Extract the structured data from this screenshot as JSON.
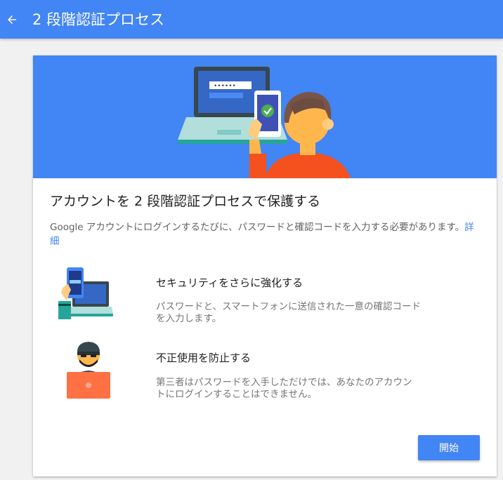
{
  "header": {
    "title": "2 段階認証プロセス",
    "back_icon": "arrow-back-icon"
  },
  "colors": {
    "primary": "#4285f4",
    "title_text": "#212121",
    "body_text": "#616161",
    "secondary_text": "#757575",
    "link": "#4285f4"
  },
  "card": {
    "title": "アカウントを 2 段階認証プロセスで保護する",
    "description": "Google アカウントにログインするたびに、パスワードと確認コードを入力する必要があります。",
    "learn_more": "詳細",
    "features": [
      {
        "icon": "phone-laptop-icon",
        "title": "セキュリティをさらに強化する",
        "description": "パスワードと、スマートフォンに送信された一意の確認コードを入力します。"
      },
      {
        "icon": "hacker-laptop-icon",
        "title": "不正使用を防止する",
        "description": "第三者はパスワードを入手しただけでは、あなたのアカウントにログインすることはできません。"
      }
    ],
    "start_button": "開始"
  },
  "hero": {
    "illustration": "laptop-phone-verification-illustration",
    "password_mask": "••••••"
  }
}
